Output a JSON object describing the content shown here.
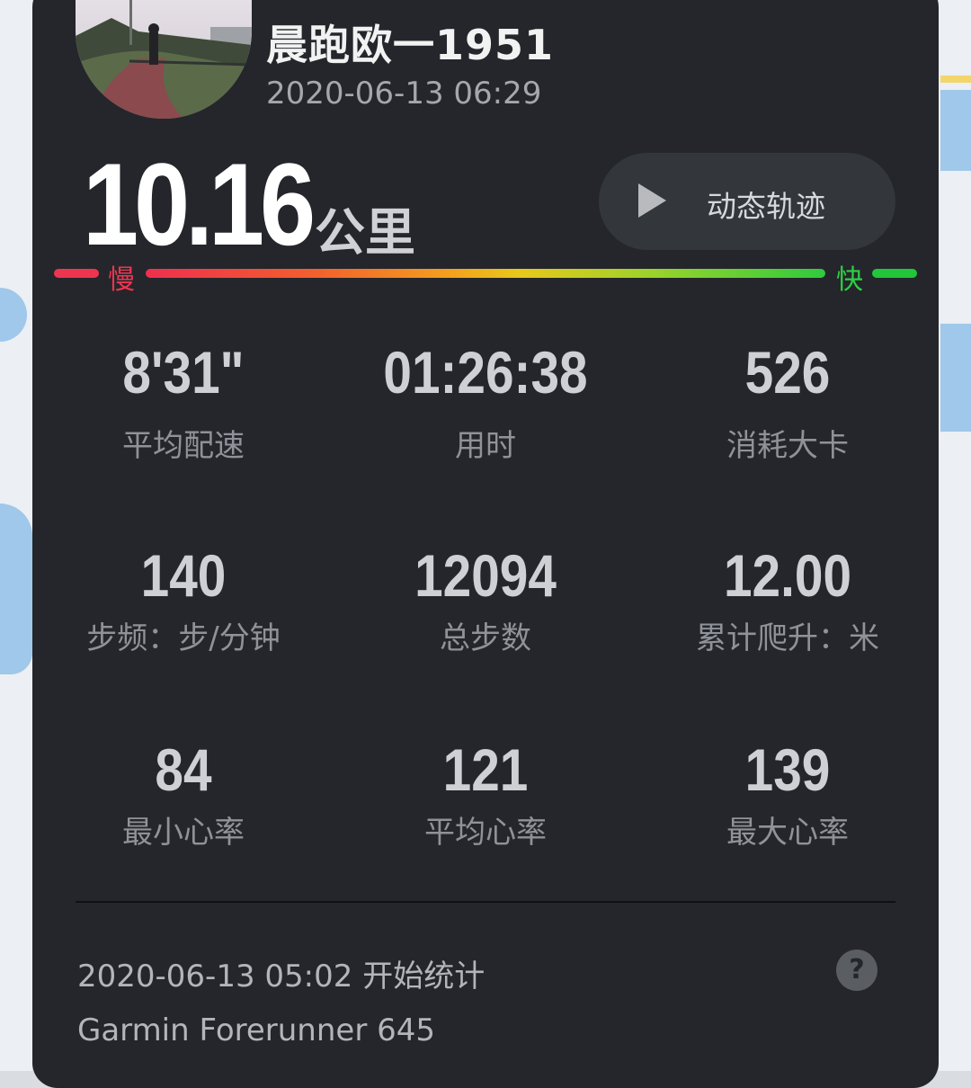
{
  "activity": {
    "title": "晨跑欧一1951",
    "datetime": "2020-06-13 06:29",
    "distance": "10.16",
    "distance_unit": "公里"
  },
  "replay_button": {
    "label": "动态轨迹"
  },
  "pace_bar": {
    "slow_label": "慢",
    "fast_label": "快",
    "slow_color": "#ee3550",
    "fast_color": "#2fcf43"
  },
  "stats": {
    "avg_pace": {
      "value": "8'31\"",
      "label": "平均配速"
    },
    "duration": {
      "value": "01:26:38",
      "label": "用时"
    },
    "calories": {
      "value": "526",
      "label": "消耗大卡"
    },
    "cadence": {
      "value": "140",
      "label": "步频：步/分钟"
    },
    "total_steps": {
      "value": "12094",
      "label": "总步数"
    },
    "elevation_gain": {
      "value": "12.00",
      "label": "累计爬升：米"
    },
    "min_hr": {
      "value": "84",
      "label": "最小心率"
    },
    "avg_hr": {
      "value": "121",
      "label": "平均心率"
    },
    "max_hr": {
      "value": "139",
      "label": "最大心率"
    }
  },
  "footer": {
    "start_text": "2020-06-13 05:02 开始统计",
    "device": "Garmin Forerunner 645",
    "help_icon": "?"
  }
}
